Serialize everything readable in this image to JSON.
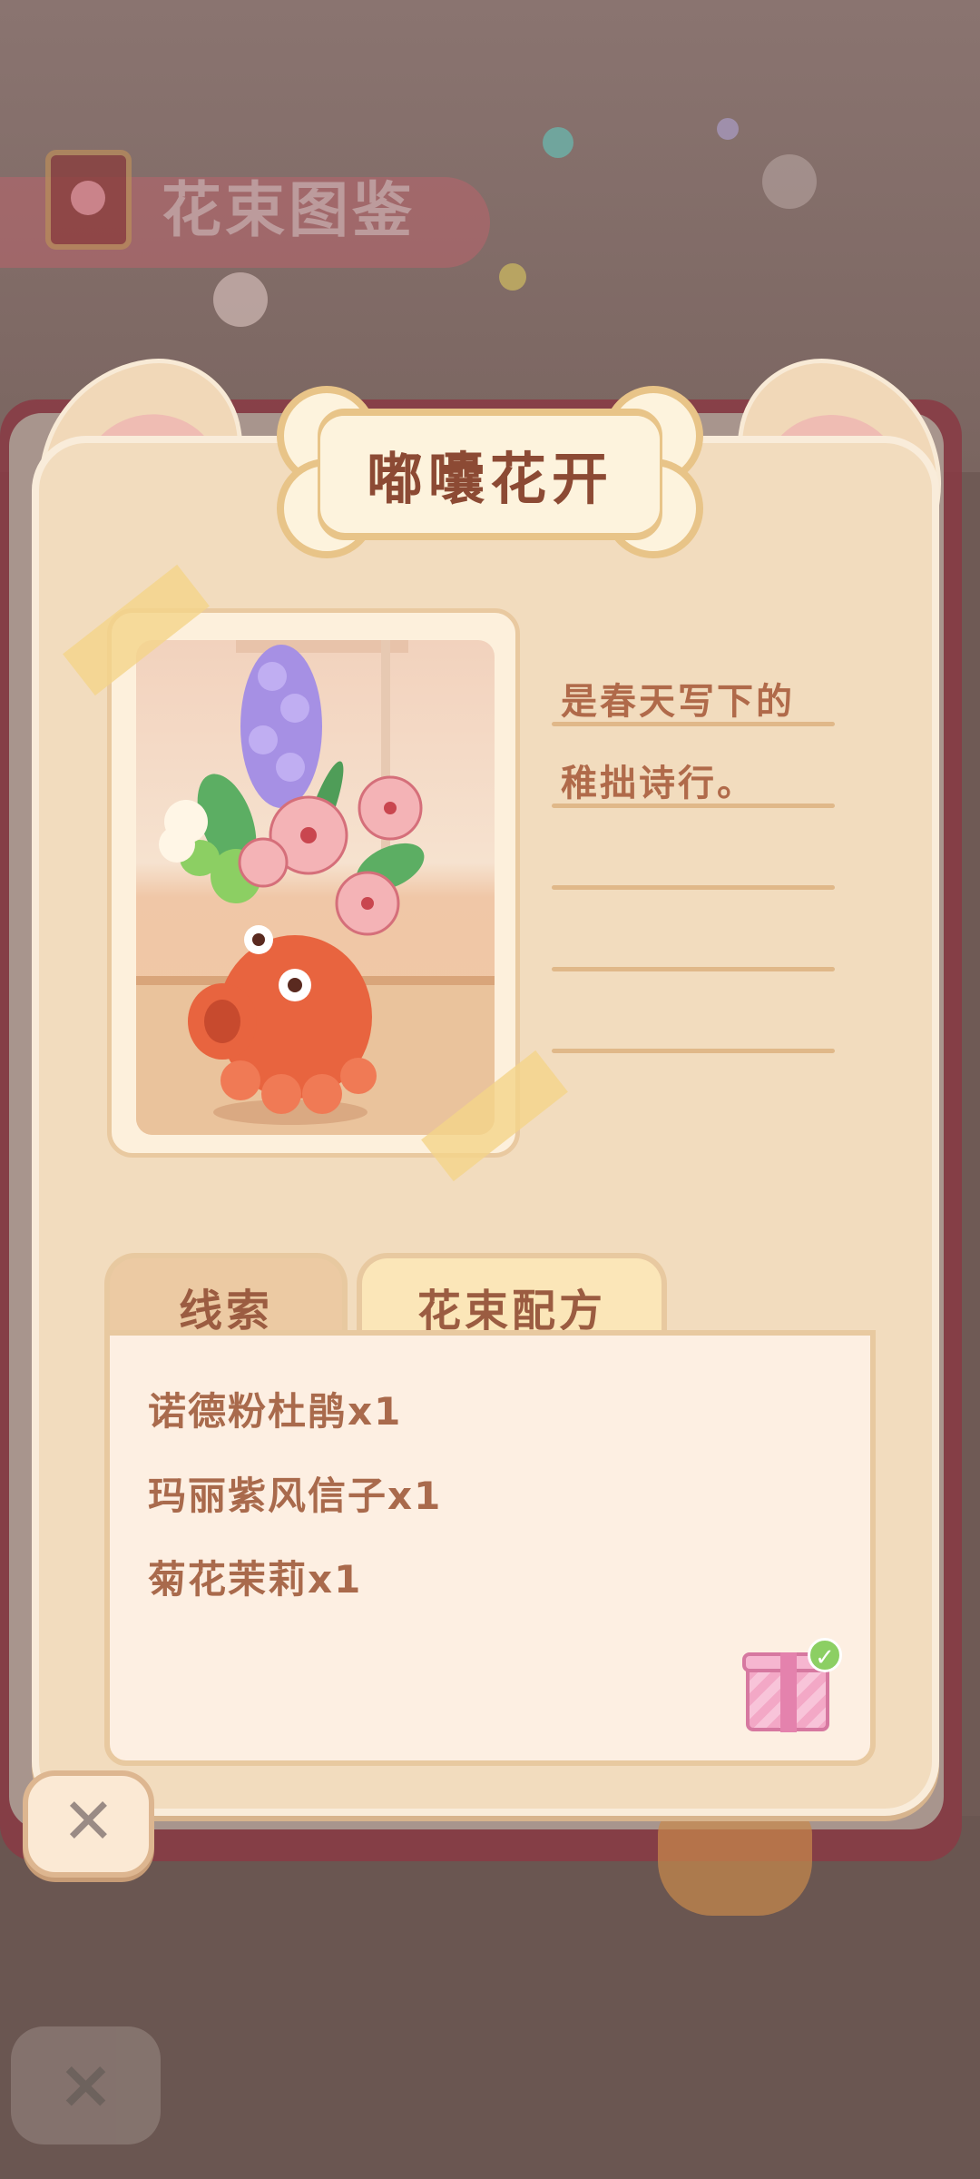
{
  "background": {
    "header_title": "花束图鉴",
    "close_icon": "×"
  },
  "card": {
    "title": "嘟囔花开",
    "image_alt": "bouquet-octopus-vase",
    "note_lines": [
      "是春天写下的",
      "稚拙诗行。",
      "",
      "",
      ""
    ]
  },
  "tabs": [
    {
      "label": "线索",
      "active": false
    },
    {
      "label": "花束配方",
      "active": true
    }
  ],
  "recipe": {
    "ingredients": [
      "诺德粉杜鹃x1",
      "玛丽紫风信子x1",
      "菊花茉莉x1"
    ]
  },
  "gift": {
    "icon": "gift-icon",
    "claimed": true,
    "check": "✓"
  },
  "close_button": {
    "icon": "close-icon",
    "glyph": "✕"
  },
  "colors": {
    "card": "#f2dcbe",
    "accent_text": "#8c4a34",
    "tab_active": "#fbe6b8",
    "ear_inner": "#efbcb3"
  }
}
